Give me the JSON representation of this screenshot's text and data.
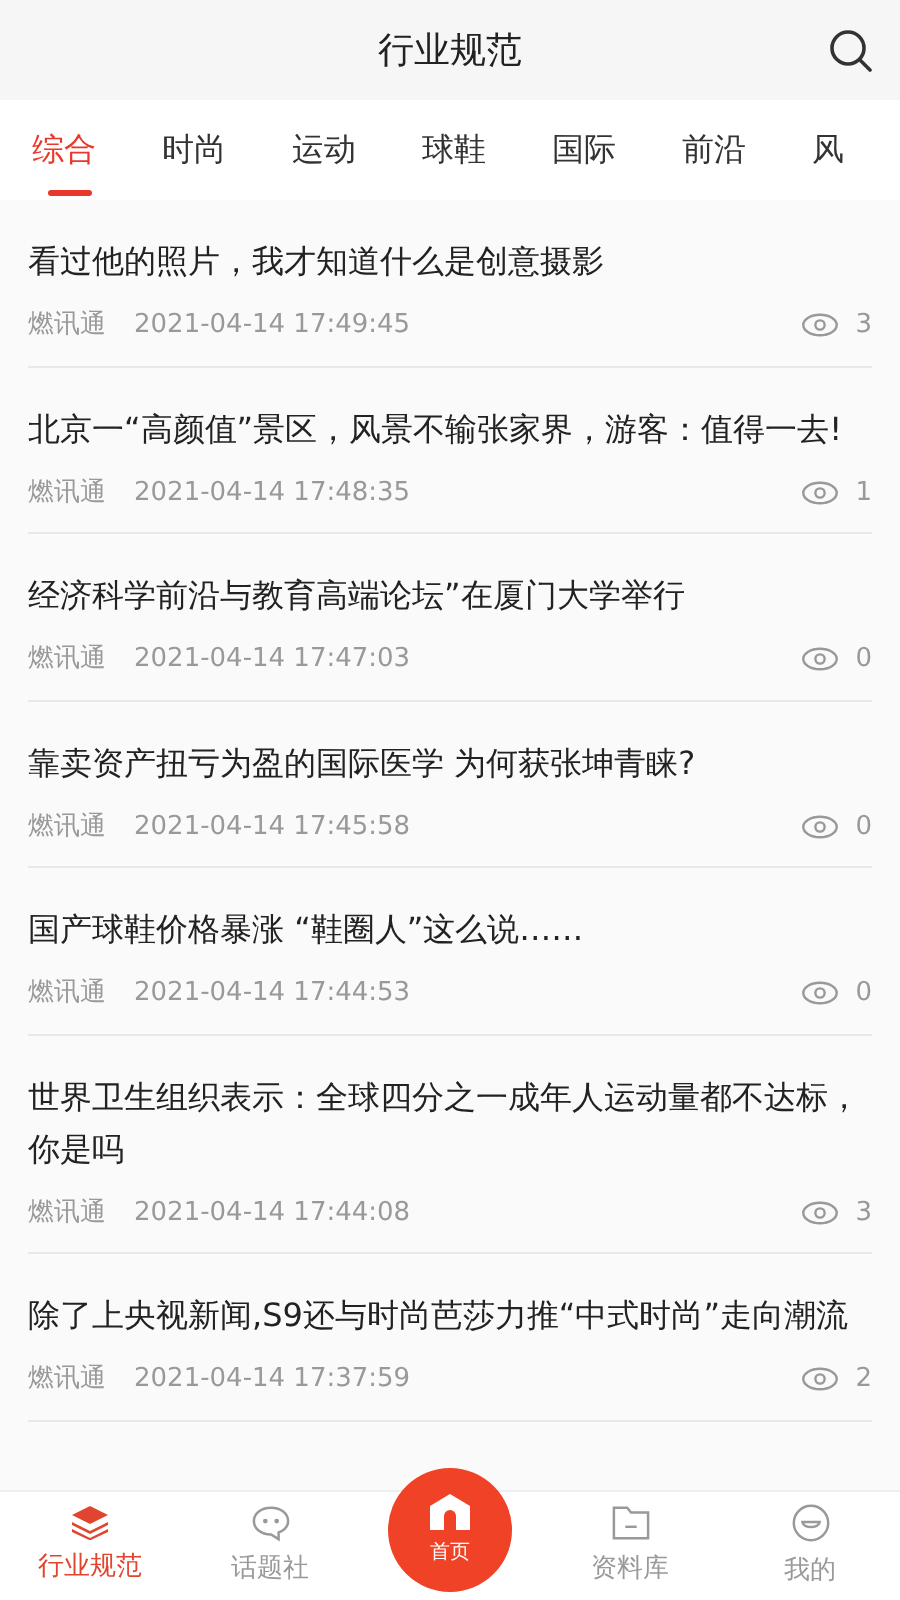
{
  "header": {
    "title": "行业规范"
  },
  "tabs": [
    {
      "label": "综合",
      "selected": true
    },
    {
      "label": "时尚",
      "selected": false
    },
    {
      "label": "运动",
      "selected": false
    },
    {
      "label": "球鞋",
      "selected": false
    },
    {
      "label": "国际",
      "selected": false
    },
    {
      "label": "前沿",
      "selected": false
    },
    {
      "label": "风",
      "selected": false
    }
  ],
  "articles": [
    {
      "title": "看过他的照片，我才知道什么是创意摄影",
      "source": "燃讯通",
      "time": "2021-04-14 17:49:45",
      "views": "3"
    },
    {
      "title": "北京一“高颜值”景区，风景不输张家界，游客：值得一去!",
      "source": "燃讯通",
      "time": "2021-04-14 17:48:35",
      "views": "1"
    },
    {
      "title": "经济科学前沿与教育高端论坛”在厦门大学举行",
      "source": "燃讯通",
      "time": "2021-04-14 17:47:03",
      "views": "0"
    },
    {
      "title": "靠卖资产扭亏为盈的国际医学 为何获张坤青睐?",
      "source": "燃讯通",
      "time": "2021-04-14 17:45:58",
      "views": "0"
    },
    {
      "title": "国产球鞋价格暴涨 “鞋圈人”这么说……",
      "source": "燃讯通",
      "time": "2021-04-14 17:44:53",
      "views": "0"
    },
    {
      "title": "世界卫生组织表示：全球四分之一成年人运动量都不达标，你是吗",
      "source": "燃讯通",
      "time": "2021-04-14 17:44:08",
      "views": "3"
    },
    {
      "title": "除了上央视新闻,S9还与时尚芭莎力推“中式时尚”走向潮流",
      "source": "燃讯通",
      "time": "2021-04-14 17:37:59",
      "views": "2"
    }
  ],
  "bottom_nav": [
    {
      "kind": "tab",
      "label": "行业规范",
      "selected": true
    },
    {
      "kind": "tab",
      "label": "话题社",
      "selected": false
    },
    {
      "kind": "home",
      "label": "首页",
      "selected": false
    },
    {
      "kind": "tab",
      "label": "资料库",
      "selected": false
    },
    {
      "kind": "tab",
      "label": "我的",
      "selected": false
    }
  ]
}
